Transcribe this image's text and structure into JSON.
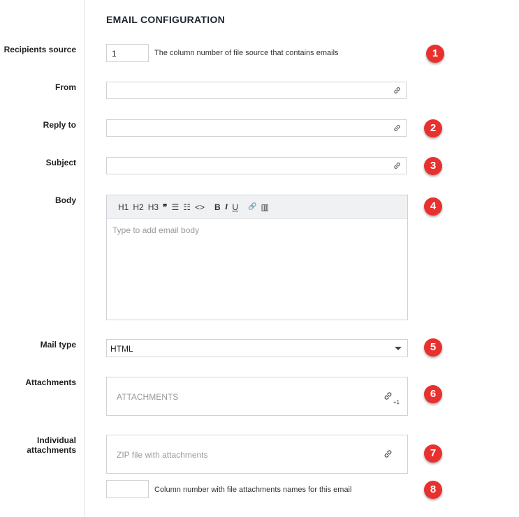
{
  "section_title": "EMAIL CONFIGURATION",
  "labels": {
    "recipients_source": "Recipients source",
    "from": "From",
    "reply_to": "Reply to",
    "subject": "Subject",
    "body": "Body",
    "mail_type": "Mail type",
    "attachments": "Attachments",
    "individual_attachments_line1": "Individual",
    "individual_attachments_line2": "attachments"
  },
  "recipients_source": {
    "value": "1",
    "hint": "The column number of file source that contains emails"
  },
  "from": {
    "value": ""
  },
  "reply_to": {
    "value": ""
  },
  "subject": {
    "value": ""
  },
  "body": {
    "toolbar": [
      "H1",
      "H2",
      "H3",
      "❞",
      "☰",
      "☷",
      "<>",
      "B",
      "I",
      "U",
      "🔗",
      "▥"
    ],
    "placeholder": "Type to add email body"
  },
  "mail_type": {
    "selected": "HTML"
  },
  "attachments": {
    "placeholder": "ATTACHMENTS",
    "count_badge": "+1"
  },
  "individual_attachments": {
    "placeholder": "ZIP file with attachments",
    "column_hint": "Column number with file attachments names for this email",
    "column_value": ""
  },
  "badges": [
    "1",
    "2",
    "3",
    "4",
    "5",
    "6",
    "7",
    "8"
  ],
  "colors": {
    "badge": "#e8312f",
    "border": "#cfd3d8",
    "toolbar_bg": "#f0f1f3"
  }
}
